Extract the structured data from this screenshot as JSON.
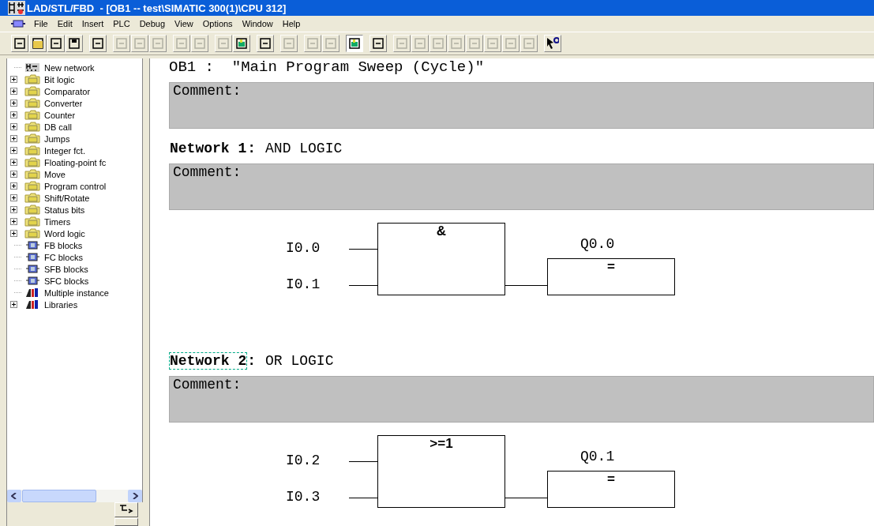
{
  "window": {
    "title": "LAD/STL/FBD  - [OB1 -- test\\SIMATIC 300(1)\\CPU 312]"
  },
  "menu": [
    "File",
    "Edit",
    "Insert",
    "PLC",
    "Debug",
    "View",
    "Options",
    "Window",
    "Help"
  ],
  "toolbar": [
    {
      "kind": "new",
      "disabled": false,
      "pressed": false
    },
    {
      "kind": "open",
      "disabled": false,
      "pressed": false
    },
    {
      "kind": "download",
      "disabled": false,
      "pressed": false
    },
    {
      "kind": "save",
      "disabled": false,
      "pressed": false
    },
    {
      "kind": "sep"
    },
    {
      "kind": "print",
      "disabled": false,
      "pressed": false
    },
    {
      "kind": "sep"
    },
    {
      "kind": "cut",
      "disabled": true,
      "pressed": false
    },
    {
      "kind": "copy",
      "disabled": true,
      "pressed": false
    },
    {
      "kind": "paste",
      "disabled": true,
      "pressed": false
    },
    {
      "kind": "sep"
    },
    {
      "kind": "undo",
      "disabled": true,
      "pressed": false
    },
    {
      "kind": "redo",
      "disabled": true,
      "pressed": false
    },
    {
      "kind": "sep"
    },
    {
      "kind": "online",
      "disabled": true,
      "pressed": false
    },
    {
      "kind": "monitor",
      "disabled": false,
      "pressed": false
    },
    {
      "kind": "sep"
    },
    {
      "kind": "tag",
      "disabled": false,
      "pressed": false
    },
    {
      "kind": "sep"
    },
    {
      "kind": "glasses",
      "disabled": true,
      "pressed": false
    },
    {
      "kind": "sep"
    },
    {
      "kind": "prev",
      "disabled": true,
      "pressed": false
    },
    {
      "kind": "next",
      "disabled": true,
      "pressed": false
    },
    {
      "kind": "sep"
    },
    {
      "kind": "overview",
      "disabled": false,
      "pressed": true
    },
    {
      "kind": "sep"
    },
    {
      "kind": "network",
      "disabled": false,
      "pressed": false
    },
    {
      "kind": "sep"
    },
    {
      "kind": "and",
      "disabled": true,
      "pressed": false
    },
    {
      "kind": "or",
      "disabled": true,
      "pressed": false
    },
    {
      "kind": "assign",
      "disabled": true,
      "pressed": false
    },
    {
      "kind": "unknown",
      "disabled": true,
      "pressed": false
    },
    {
      "kind": "branch",
      "disabled": true,
      "pressed": false
    },
    {
      "kind": "connector",
      "disabled": true,
      "pressed": false
    },
    {
      "kind": "open-branch",
      "disabled": true,
      "pressed": false
    },
    {
      "kind": "close-branch",
      "disabled": true,
      "pressed": false
    },
    {
      "kind": "sep"
    },
    {
      "kind": "help",
      "disabled": false,
      "pressed": false
    }
  ],
  "sidebar": {
    "items": [
      {
        "label": "New network",
        "kind": "network"
      },
      {
        "label": "Bit logic",
        "kind": "folder"
      },
      {
        "label": "Comparator",
        "kind": "folder"
      },
      {
        "label": "Converter",
        "kind": "folder"
      },
      {
        "label": "Counter",
        "kind": "folder"
      },
      {
        "label": "DB call",
        "kind": "folder"
      },
      {
        "label": "Jumps",
        "kind": "folder"
      },
      {
        "label": "Integer fct.",
        "kind": "folder"
      },
      {
        "label": "Floating-point fc",
        "kind": "folder"
      },
      {
        "label": "Move",
        "kind": "folder"
      },
      {
        "label": "Program control",
        "kind": "folder"
      },
      {
        "label": "Shift/Rotate",
        "kind": "folder"
      },
      {
        "label": "Status bits",
        "kind": "folder"
      },
      {
        "label": "Timers",
        "kind": "folder"
      },
      {
        "label": "Word logic",
        "kind": "folder"
      },
      {
        "label": "FB blocks",
        "kind": "block"
      },
      {
        "label": "FC blocks",
        "kind": "block"
      },
      {
        "label": "SFB blocks",
        "kind": "block"
      },
      {
        "label": "SFC blocks",
        "kind": "block"
      },
      {
        "label": "Multiple instance",
        "kind": "instance"
      },
      {
        "label": "Libraries",
        "kind": "library"
      }
    ]
  },
  "editor": {
    "block_title": "OB1 :  \"Main Program Sweep (Cycle)\"",
    "block_comment": "Comment:",
    "networks": [
      {
        "title": "Network 1",
        "separator": ":",
        "label": "AND LOGIC",
        "focused": false,
        "comment": "Comment:",
        "symbol": "&",
        "inputs": [
          "I0.0",
          "I0.1"
        ],
        "output": "Q0.0",
        "output_symbol": "="
      },
      {
        "title": "Network 2",
        "separator": ":",
        "label": "OR LOGIC",
        "focused": true,
        "comment": "Comment:",
        "symbol": ">=1",
        "inputs": [
          "I0.2",
          "I0.3"
        ],
        "output": "Q0.1",
        "output_symbol": "="
      }
    ]
  }
}
